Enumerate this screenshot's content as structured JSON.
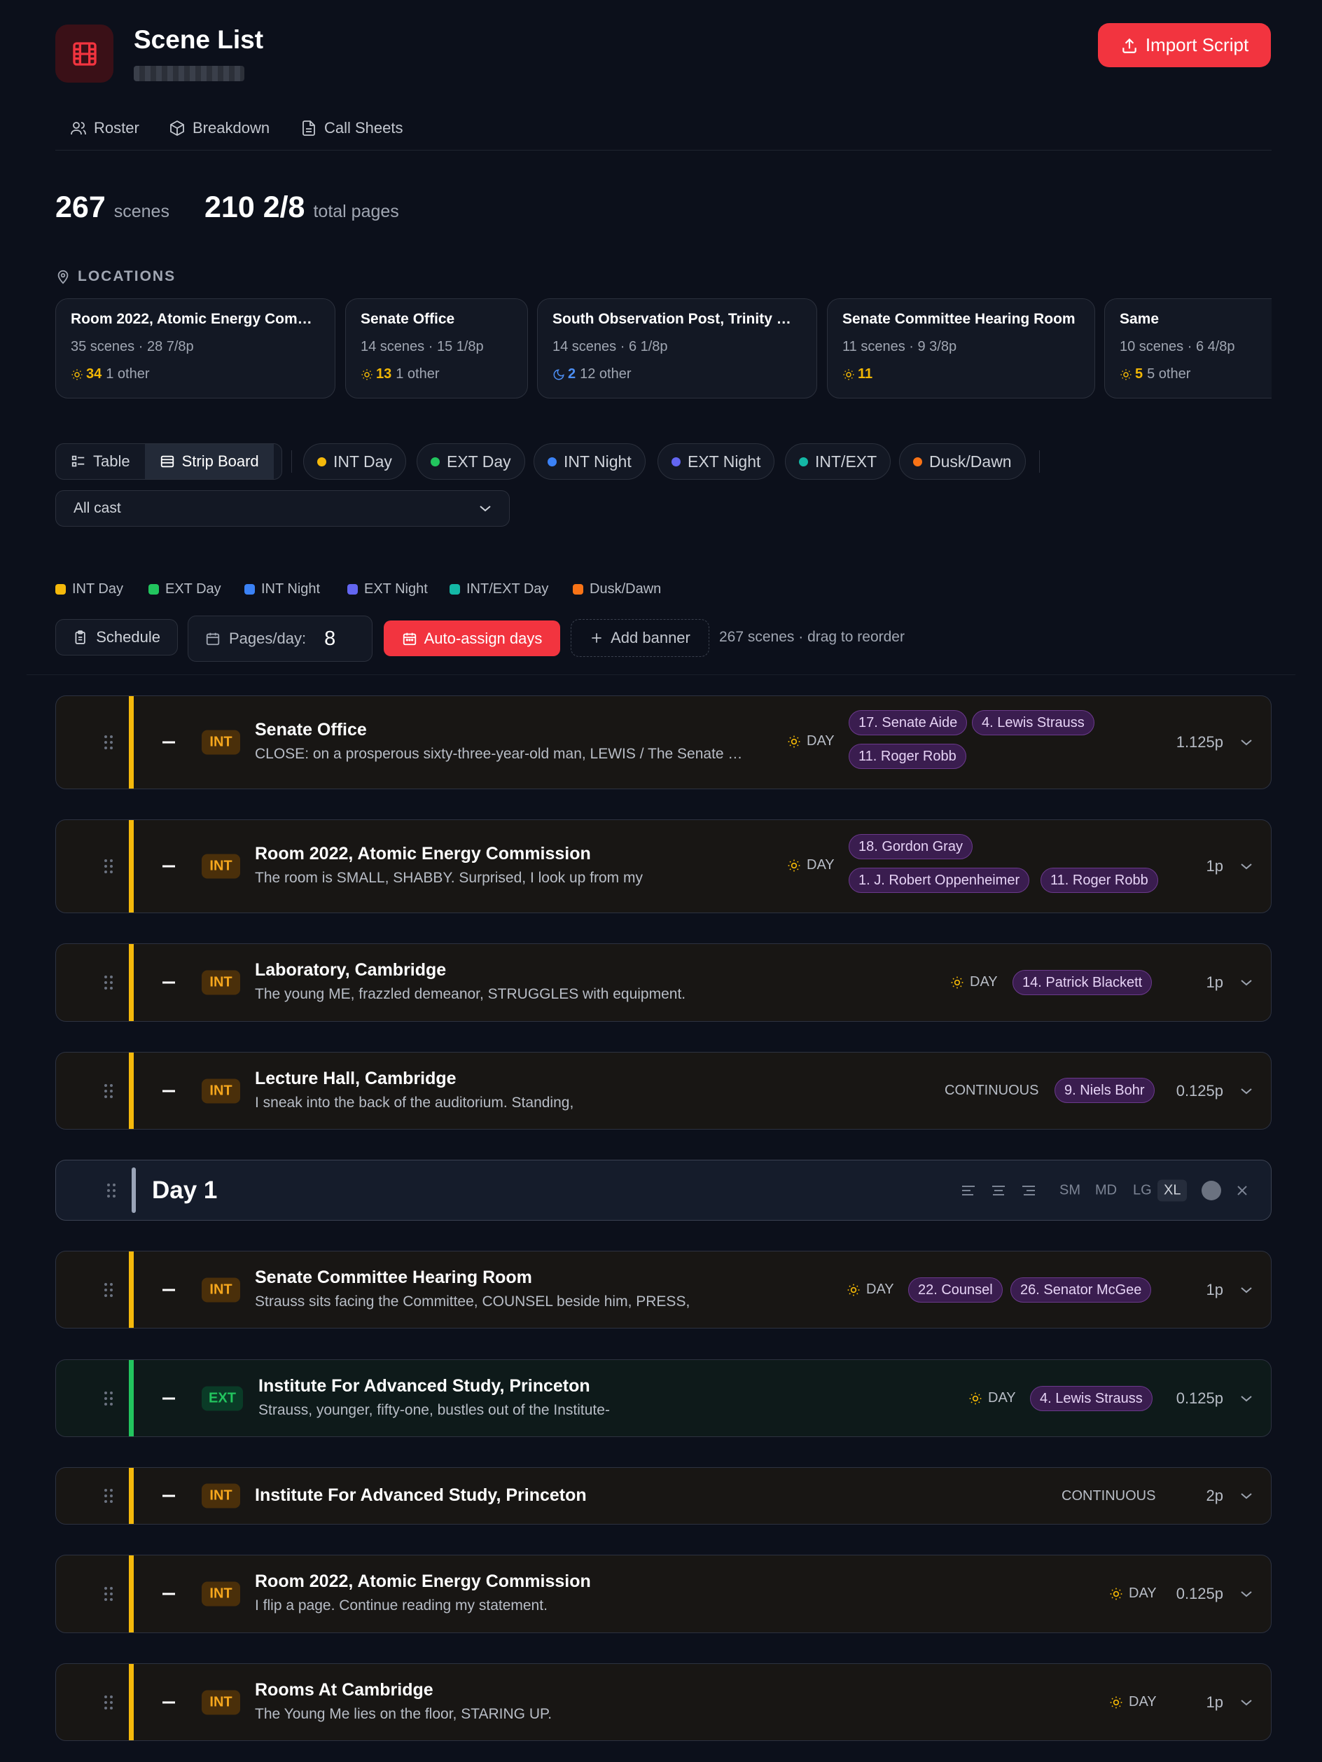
{
  "header": {
    "title": "Scene List",
    "import_label": "Import Script"
  },
  "nav": [
    {
      "label": "Roster",
      "icon": "users-icon"
    },
    {
      "label": "Breakdown",
      "icon": "box-icon"
    },
    {
      "label": "Call Sheets",
      "icon": "file-icon"
    }
  ],
  "stats": {
    "scenes_value": "267",
    "scenes_unit": "scenes",
    "pages_value": "210 2/8",
    "pages_unit": "total pages"
  },
  "locations": {
    "heading": "LOCATIONS",
    "cards": [
      {
        "name": "Room 2022, Atomic Energy Com…",
        "meta": "35 scenes · 28 7/8p",
        "count": "34",
        "count_type": "sun",
        "other": "1 other"
      },
      {
        "name": "Senate Office",
        "meta": "14 scenes · 15 1/8p",
        "count": "13",
        "count_type": "sun",
        "other": "1 other"
      },
      {
        "name": "South Observation Post, Trinity …",
        "meta": "14 scenes · 6 1/8p",
        "count": "2",
        "count_type": "moon",
        "other": "12 other"
      },
      {
        "name": "Senate Committee Hearing Room",
        "meta": "11 scenes · 9 3/8p",
        "count": "11",
        "count_type": "sun",
        "other": ""
      },
      {
        "name": "Same",
        "meta": "10 scenes · 6 4/8p",
        "count": "5",
        "count_type": "sun",
        "other": "5 other"
      }
    ]
  },
  "view_toggle": {
    "table_label": "Table",
    "strip_label": "Strip Board"
  },
  "filters": [
    {
      "label": "INT Day",
      "color": "#f5b90b"
    },
    {
      "label": "EXT Day",
      "color": "#22c55e"
    },
    {
      "label": "INT Night",
      "color": "#3b82f6"
    },
    {
      "label": "EXT Night",
      "color": "#6366f1"
    },
    {
      "label": "INT/EXT",
      "color": "#14b8a6"
    },
    {
      "label": "Dusk/Dawn",
      "color": "#f97316"
    }
  ],
  "cast_select": {
    "value": "All cast"
  },
  "legend": [
    {
      "label": "INT Day",
      "color": "#f5b90b"
    },
    {
      "label": "EXT Day",
      "color": "#22c55e"
    },
    {
      "label": "INT Night",
      "color": "#3b82f6"
    },
    {
      "label": "EXT Night",
      "color": "#6366f1"
    },
    {
      "label": "INT/EXT Day",
      "color": "#14b8a6"
    },
    {
      "label": "Dusk/Dawn",
      "color": "#f97316"
    }
  ],
  "toolbar": {
    "schedule_label": "Schedule",
    "pages_per_day_label": "Pages/day:",
    "pages_per_day_value": "8",
    "auto_assign_label": "Auto-assign days",
    "add_banner_label": "Add banner",
    "hint": "267 scenes · drag to reorder"
  },
  "strips": [
    {
      "badge": "INT",
      "title": "Senate Office",
      "desc": "CLOSE: on a prosperous sixty-three-year-old man, LEWIS / The Senate …",
      "tod": "DAY",
      "cast": [
        "17. Senate Aide",
        "4. Lewis Strauss",
        "11. Roger Robb"
      ],
      "pages": "1.125p"
    },
    {
      "badge": "INT",
      "title": "Room 2022, Atomic Energy Commission",
      "desc": "The room is SMALL, SHABBY. Surprised, I look up from my",
      "tod": "DAY",
      "cast": [
        "18. Gordon Gray",
        "1. J. Robert Oppenheimer",
        "11. Roger Robb"
      ],
      "pages": "1p"
    },
    {
      "badge": "INT",
      "title": "Laboratory, Cambridge",
      "desc": "The young ME, frazzled demeanor, STRUGGLES with equipment.",
      "tod": "DAY",
      "cast": [
        "14. Patrick Blackett"
      ],
      "pages": "1p"
    },
    {
      "badge": "INT",
      "title": "Lecture Hall, Cambridge",
      "desc": "I sneak into the back of the auditorium. Standing,",
      "tod": "CONTINUOUS",
      "cast": [
        "9. Niels Bohr"
      ],
      "pages": "0.125p"
    },
    {
      "badge": "INT",
      "title": "Senate Committee Hearing Room",
      "desc": "Strauss sits facing the Committee, COUNSEL beside him, PRESS,",
      "tod": "DAY",
      "cast": [
        "22. Counsel",
        "26. Senator McGee"
      ],
      "pages": "1p"
    },
    {
      "badge": "EXT",
      "title": "Institute For Advanced Study, Princeton",
      "desc": "Strauss, younger, fifty-one, bustles out of the Institute-",
      "tod": "DAY",
      "cast": [
        "4. Lewis Strauss"
      ],
      "pages": "0.125p"
    },
    {
      "badge": "INT",
      "title": "Institute For Advanced Study, Princeton",
      "desc": "",
      "tod": "CONTINUOUS",
      "cast": [],
      "pages": "2p"
    },
    {
      "badge": "INT",
      "title": "Room 2022, Atomic Energy Commission",
      "desc": "I flip a page. Continue reading my statement.",
      "tod": "DAY",
      "cast": [],
      "pages": "0.125p"
    },
    {
      "badge": "INT",
      "title": "Rooms At Cambridge",
      "desc": "The Young Me lies on the floor, STARING UP.",
      "tod": "DAY",
      "cast": [],
      "pages": "1p"
    }
  ],
  "banner": {
    "title": "Day 1",
    "sizes": [
      "SM",
      "MD",
      "LG",
      "XL"
    ],
    "selected_size": "XL"
  },
  "colors": {
    "accent": "#f2343f",
    "int_day": "#f5b90b",
    "ext_day": "#22c55e",
    "cast_chip": "#3a1d4f"
  }
}
